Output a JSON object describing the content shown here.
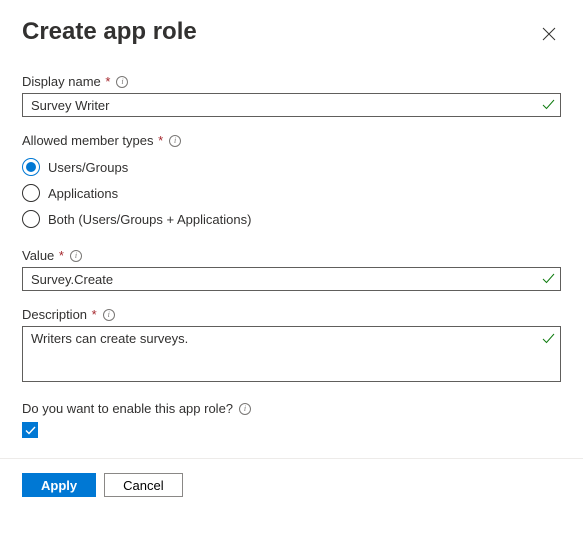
{
  "header": {
    "title": "Create app role"
  },
  "display_name": {
    "label": "Display name",
    "required": true,
    "value": "Survey Writer"
  },
  "member_types": {
    "label": "Allowed member types",
    "required": true,
    "options": [
      {
        "label": "Users/Groups",
        "selected": true
      },
      {
        "label": "Applications",
        "selected": false
      },
      {
        "label": "Both (Users/Groups + Applications)",
        "selected": false
      }
    ]
  },
  "value_field": {
    "label": "Value",
    "required": true,
    "value": "Survey.Create"
  },
  "description": {
    "label": "Description",
    "required": true,
    "value": "Writers can create surveys."
  },
  "enable": {
    "label": "Do you want to enable this app role?",
    "checked": true
  },
  "footer": {
    "apply": "Apply",
    "cancel": "Cancel"
  }
}
